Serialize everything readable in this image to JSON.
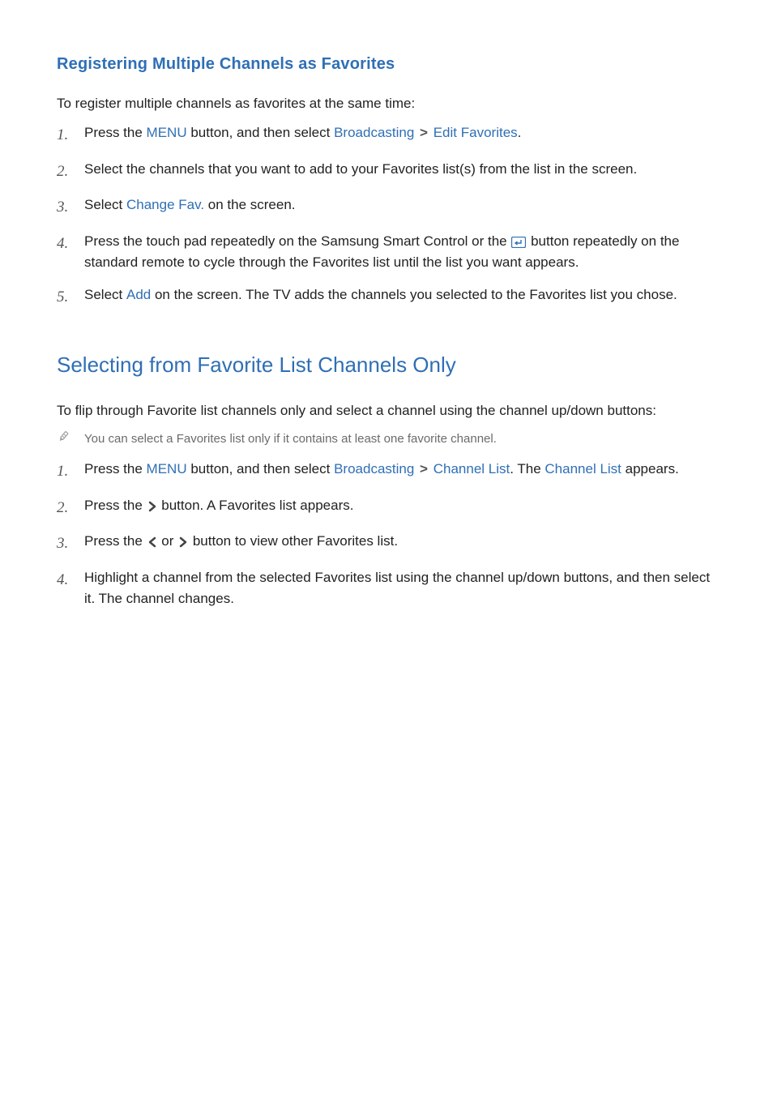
{
  "section1": {
    "title": "Registering Multiple Channels as Favorites",
    "intro": "To register multiple channels as favorites at the same time:",
    "steps": {
      "s1": {
        "num": "1.",
        "t1": "Press the ",
        "menu": "MENU",
        "t2": " button, and then select ",
        "broadcasting": "Broadcasting",
        "gt": ">",
        "editfav": "Edit Favorites",
        "t3": "."
      },
      "s2": {
        "num": "2.",
        "text": "Select the channels that you want to add to your Favorites list(s) from the list in the screen."
      },
      "s3": {
        "num": "3.",
        "t1": "Select ",
        "chfav": "Change Fav.",
        "t2": " on the screen."
      },
      "s4": {
        "num": "4.",
        "t1": "Press the touch pad repeatedly on the Samsung Smart Control or the ",
        "t2": " button repeatedly on the standard remote to cycle through the Favorites list until the list you want appears."
      },
      "s5": {
        "num": "5.",
        "t1": "Select ",
        "add": "Add",
        "t2": " on the screen. The TV adds the channels you selected to the Favorites list you chose."
      }
    }
  },
  "section2": {
    "title": "Selecting from Favorite List Channels Only",
    "intro": "To flip through Favorite list channels only and select a channel using the channel up/down buttons:",
    "note": "You can select a Favorites list only if it contains at least one favorite channel.",
    "steps": {
      "s1": {
        "num": "1.",
        "t1": "Press the ",
        "menu": "MENU",
        "t2": " button, and then select ",
        "broadcasting": "Broadcasting",
        "gt": ">",
        "chlist": "Channel List",
        "t3": ". The ",
        "chlist2": "Channel List",
        "t4": " appears."
      },
      "s2": {
        "num": "2.",
        "t1": "Press the ",
        "t2": " button. A Favorites list appears."
      },
      "s3": {
        "num": "3.",
        "t1": "Press the ",
        "or": " or ",
        "t2": " button to view other Favorites list."
      },
      "s4": {
        "num": "4.",
        "text": "Highlight a channel from the selected Favorites list using the channel up/down buttons, and then select it. The channel changes."
      }
    }
  }
}
